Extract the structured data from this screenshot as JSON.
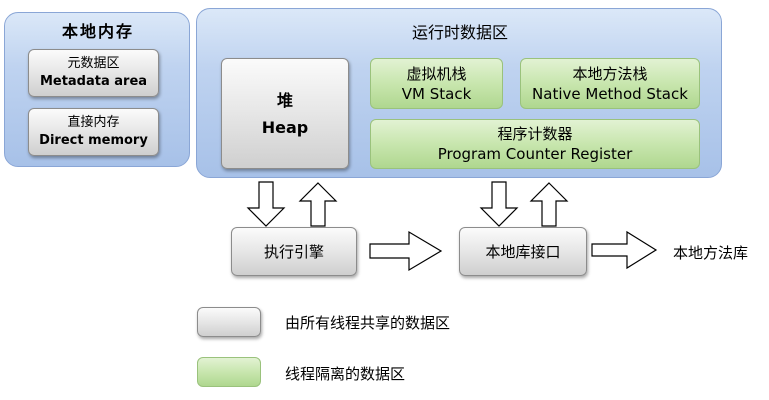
{
  "native_memory": {
    "title": "本地内存",
    "metadata": {
      "cn": "元数据区",
      "en": "Metadata area"
    },
    "direct": {
      "cn": "直接内存",
      "en": "Direct memory"
    }
  },
  "runtime_area": {
    "title": "运行时数据区",
    "heap": {
      "cn": "堆",
      "en": "Heap"
    },
    "vm_stack": {
      "cn": "虚拟机栈",
      "en": "VM Stack"
    },
    "native_method_stack": {
      "cn": "本地方法栈",
      "en": "Native Method Stack"
    },
    "pc_register": {
      "cn": "程序计数器",
      "en": "Program Counter Register"
    }
  },
  "flow": {
    "execution_engine": "执行引擎",
    "native_interface": "本地库接口",
    "native_library": "本地方法库"
  },
  "legend": [
    {
      "label": "由所有线程共享的数据区",
      "color": "#d9d9d9"
    },
    {
      "label": "线程隔离的数据区",
      "color": "#b9dc9b"
    }
  ],
  "colors": {
    "panel": "#b4cbec",
    "shared": "#d9d9d9",
    "isolated": "#b9dc9b"
  }
}
